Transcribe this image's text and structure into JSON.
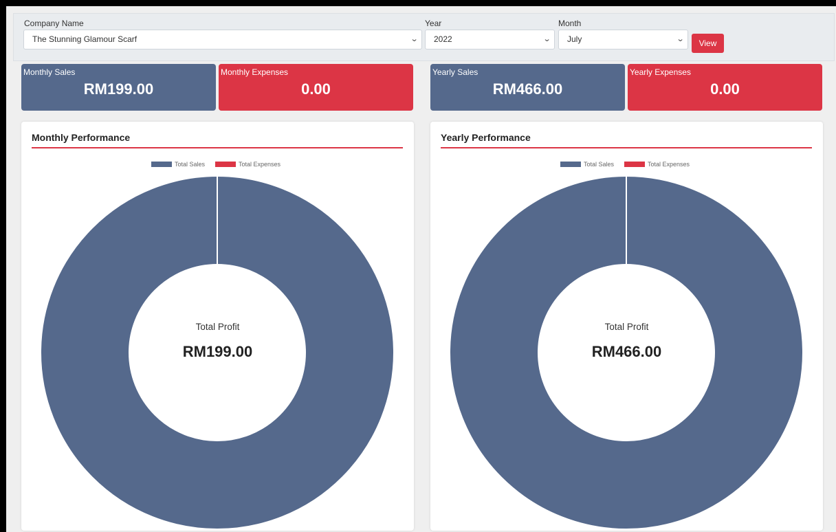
{
  "filters": {
    "company_label": "Company Name",
    "company_value": "The Stunning Glamour Scarf",
    "year_label": "Year",
    "year_value": "2022",
    "month_label": "Month",
    "month_value": "July",
    "view_label": "View"
  },
  "stats": {
    "monthly_sales_label": "Monthly Sales",
    "monthly_sales_value": "RM199.00",
    "monthly_expenses_label": "Monthly Expenses",
    "monthly_expenses_value": "0.00",
    "yearly_sales_label": "Yearly Sales",
    "yearly_sales_value": "RM466.00",
    "yearly_expenses_label": "Yearly Expenses",
    "yearly_expenses_value": "0.00"
  },
  "monthly": {
    "title": "Monthly Performance",
    "center_label": "Total Profit",
    "center_value": "RM199.00"
  },
  "yearly": {
    "title": "Yearly Performance",
    "center_label": "Total Profit",
    "center_value": "RM466.00"
  },
  "colors": {
    "sales": "#55698c",
    "expenses": "#dc3545"
  },
  "chart_data": [
    {
      "type": "pie",
      "title": "Monthly Performance",
      "categories": [
        "Total Sales",
        "Total Expenses"
      ],
      "values": [
        199,
        0
      ],
      "legend": "top"
    },
    {
      "type": "pie",
      "title": "Yearly Performance",
      "categories": [
        "Total Sales",
        "Total Expenses"
      ],
      "values": [
        466,
        0
      ],
      "legend": "top"
    }
  ]
}
